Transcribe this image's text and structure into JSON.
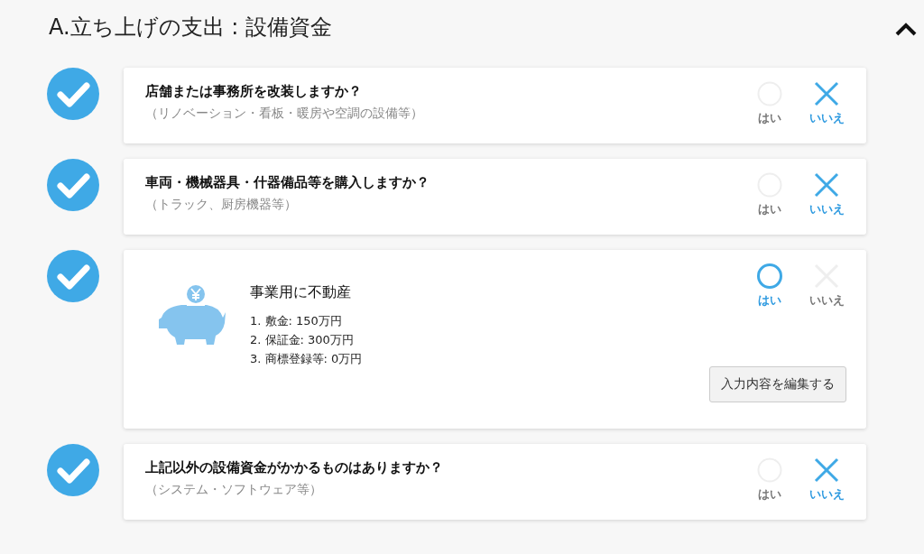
{
  "section": {
    "title": "A.立ち上げの支出 : 設備資金",
    "expanded": true
  },
  "items": [
    {
      "kind": "question",
      "done": true,
      "title": "店舗または事務所を改装しますか？",
      "note": "（リノベーション・看板・暖房や空調の設備等）",
      "options": [
        {
          "kind": "yes",
          "label": "はい",
          "selected": false
        },
        {
          "kind": "no",
          "label": "いいえ",
          "selected": true
        }
      ]
    },
    {
      "kind": "question",
      "done": true,
      "title": "車両・機械器具・什器備品等を購入しますか？",
      "note": "（トラック、厨房機器等）",
      "options": [
        {
          "kind": "yes",
          "label": "はい",
          "selected": false
        },
        {
          "kind": "no",
          "label": "いいえ",
          "selected": true
        }
      ]
    },
    {
      "kind": "summary",
      "done": true,
      "title": "事業用に不動産",
      "lines": [
        "1. 敷金: 150万円",
        "2. 保証金: 300万円",
        "3. 商標登録等: 0万円"
      ],
      "button": "入力内容を編集する",
      "options": [
        {
          "kind": "yes",
          "label": "はい",
          "selected": true
        },
        {
          "kind": "no",
          "label": "いいえ",
          "selected": false
        }
      ]
    },
    {
      "kind": "question",
      "done": true,
      "title": "上記以外の設備資金がかかるものはありますか？",
      "note": "（システム・ソフトウェア等）",
      "options": [
        {
          "kind": "yes",
          "label": "はい",
          "selected": false
        },
        {
          "kind": "no",
          "label": "いいえ",
          "selected": true
        }
      ]
    }
  ]
}
